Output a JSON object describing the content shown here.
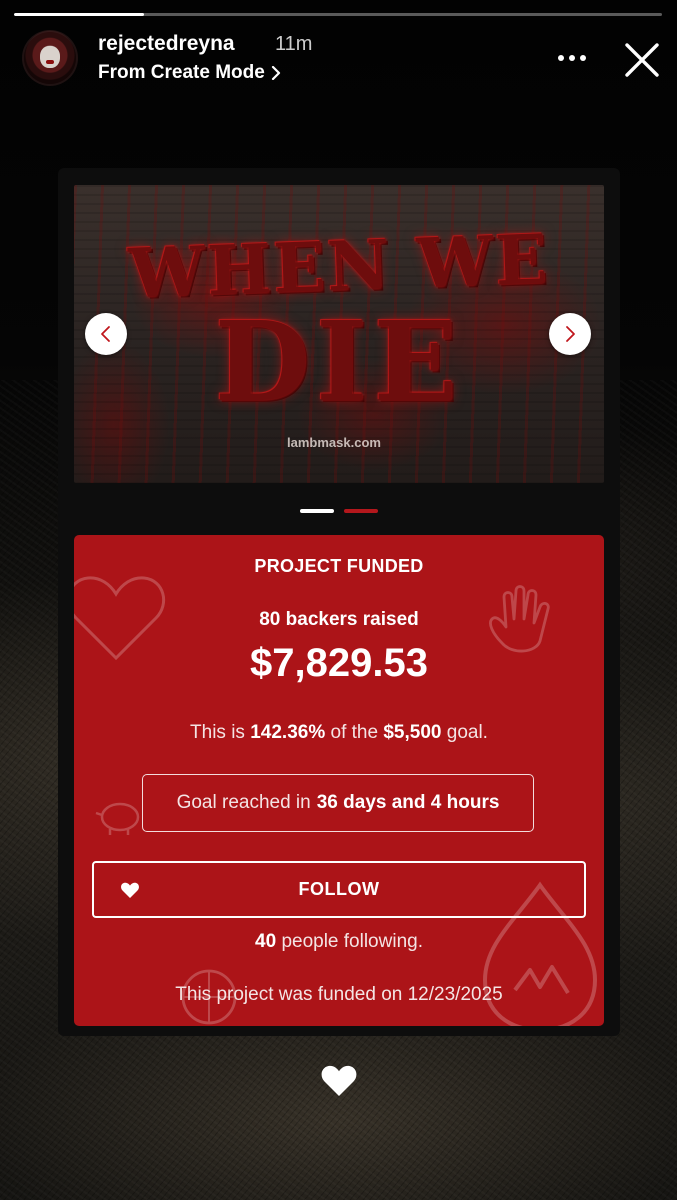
{
  "story": {
    "progress_fraction": 0.2,
    "username": "rejectedreyna",
    "time_ago": "11m",
    "source_label": "From Create Mode"
  },
  "hero": {
    "title_line1": "WHEN WE",
    "title_line2": "DIE",
    "url": "lambmask.com"
  },
  "carousel": {
    "active_index": 0,
    "count": 2
  },
  "funding": {
    "status_label": "PROJECT FUNDED",
    "backers_text": "80 backers raised",
    "amount": "$7,829.53",
    "goal_prefix": "This is",
    "goal_percent": "142.36%",
    "goal_middle": "of the",
    "goal_amount": "$5,500",
    "goal_suffix": "goal.",
    "reached_prefix": "Goal reached in",
    "reached_duration": "36 days and 4 hours",
    "follow_label": "FOLLOW",
    "followers_count": "40",
    "followers_suffix": "people following.",
    "funded_date_text": "This project was funded on 12/23/2025"
  },
  "colors": {
    "panel_red": "#ac1418",
    "accent_white": "#ffffff"
  },
  "icons": [
    "more-options-icon",
    "close-icon",
    "chevron-left-icon",
    "chevron-right-icon",
    "heart-icon",
    "like-heart-icon"
  ]
}
